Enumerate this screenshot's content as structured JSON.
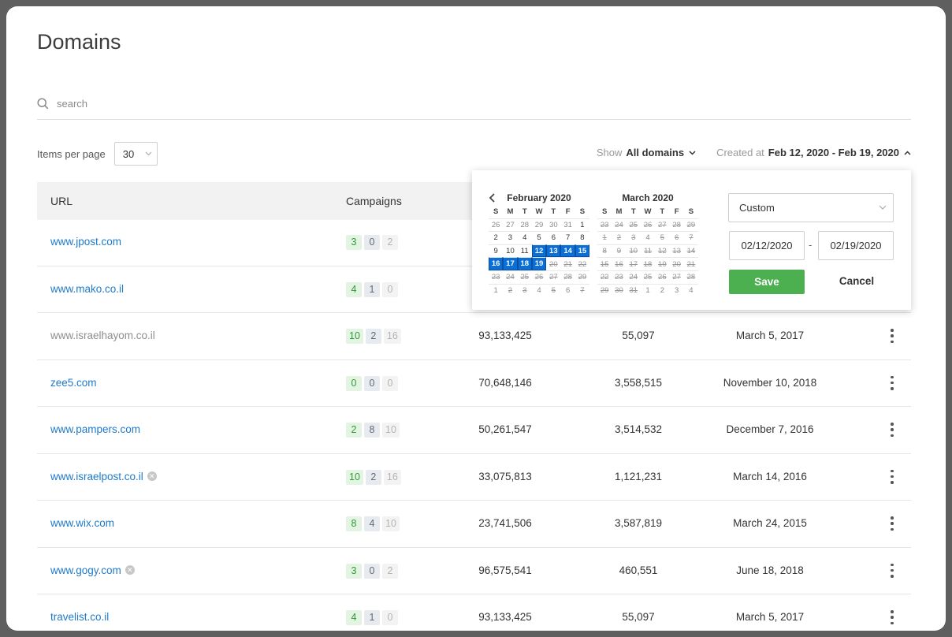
{
  "page": {
    "title": "Domains"
  },
  "search": {
    "placeholder": "search"
  },
  "paging": {
    "label": "Items per page",
    "value": "30"
  },
  "filters": {
    "show_label": "Show",
    "show_value": "All domains",
    "created_label": "Created at",
    "created_value": "Feb 12, 2020 - Feb 19, 2020"
  },
  "table": {
    "headers": {
      "url": "URL",
      "campaigns": "Campaigns"
    },
    "rows": [
      {
        "url": "www.jpost.com",
        "badges": [
          "3",
          "0",
          "2"
        ],
        "c3": "",
        "c4": "",
        "c5": "",
        "x": false,
        "dim": false
      },
      {
        "url": "www.mako.co.il",
        "badges": [
          "4",
          "1",
          "0"
        ],
        "c3": "",
        "c4": "",
        "c5": "",
        "x": false,
        "dim": false
      },
      {
        "url": "www.israelhayom.co.il",
        "badges": [
          "10",
          "2",
          "16"
        ],
        "c3": "93,133,425",
        "c4": "55,097",
        "c5": "March 5, 2017",
        "x": false,
        "dim": true
      },
      {
        "url": "zee5.com",
        "badges": [
          "0",
          "0",
          "0"
        ],
        "c3": "70,648,146",
        "c4": "3,558,515",
        "c5": "November 10, 2018",
        "x": false,
        "dim": false
      },
      {
        "url": "www.pampers.com",
        "badges": [
          "2",
          "8",
          "10"
        ],
        "c3": "50,261,547",
        "c4": "3,514,532",
        "c5": "December 7, 2016",
        "x": false,
        "dim": false
      },
      {
        "url": "www.israelpost.co.il",
        "badges": [
          "10",
          "2",
          "16"
        ],
        "c3": "33,075,813",
        "c4": "1,121,231",
        "c5": "March 14, 2016",
        "x": true,
        "dim": false
      },
      {
        "url": "www.wix.com",
        "badges": [
          "8",
          "4",
          "10"
        ],
        "c3": "23,741,506",
        "c4": "3,587,819",
        "c5": "March 24, 2015",
        "x": false,
        "dim": false
      },
      {
        "url": "www.gogy.com",
        "badges": [
          "3",
          "0",
          "2"
        ],
        "c3": "96,575,541",
        "c4": "460,551",
        "c5": "June 18, 2018",
        "x": true,
        "dim": false
      },
      {
        "url": "travelist.co.il",
        "badges": [
          "4",
          "1",
          "0"
        ],
        "c3": "93,133,425",
        "c4": "55,097",
        "c5": "March 5, 2017",
        "x": false,
        "dim": false
      }
    ]
  },
  "datepicker": {
    "weekdays": [
      "S",
      "M",
      "T",
      "W",
      "T",
      "F",
      "S"
    ],
    "months": [
      {
        "name": "February 2020",
        "weeks": [
          [
            "26",
            "27",
            "28",
            "29",
            "30",
            "31",
            "1"
          ],
          [
            "2",
            "3",
            "4",
            "5",
            "6",
            "7",
            "8"
          ],
          [
            "9",
            "10",
            "11",
            "12",
            "13",
            "14",
            "15"
          ],
          [
            "16",
            "17",
            "18",
            "19",
            "20",
            "21",
            "22"
          ],
          [
            "23",
            "24",
            "25",
            "26",
            "27",
            "28",
            "29"
          ],
          [
            "1",
            "2",
            "3",
            "4",
            "5",
            "6",
            "7"
          ]
        ],
        "states": [
          [
            "oth",
            "oth",
            "oth",
            "oth",
            "oth",
            "oth",
            "cur"
          ],
          [
            "cur",
            "cur",
            "cur",
            "cur",
            "cur",
            "cur",
            "cur"
          ],
          [
            "cur",
            "cur",
            "cur",
            "sel",
            "sel",
            "sel",
            "sel"
          ],
          [
            "sel",
            "sel",
            "sel",
            "sel",
            "dis",
            "dis",
            "dis"
          ],
          [
            "dis",
            "dis",
            "dis",
            "dis",
            "dis",
            "dis",
            "dis"
          ],
          [
            "oth",
            "dis",
            "dis",
            "oth",
            "dis",
            "oth",
            "dis"
          ]
        ]
      },
      {
        "name": "March 2020",
        "weeks": [
          [
            "23",
            "24",
            "25",
            "26",
            "27",
            "28",
            "29"
          ],
          [
            "1",
            "2",
            "3",
            "4",
            "5",
            "6",
            "7"
          ],
          [
            "8",
            "9",
            "10",
            "11",
            "12",
            "13",
            "14"
          ],
          [
            "15",
            "16",
            "17",
            "18",
            "19",
            "20",
            "21"
          ],
          [
            "22",
            "23",
            "24",
            "25",
            "26",
            "27",
            "28"
          ],
          [
            "29",
            "30",
            "31",
            "1",
            "2",
            "3",
            "4"
          ]
        ],
        "states": [
          [
            "dis",
            "dis",
            "dis",
            "dis",
            "dis",
            "dis",
            "dis"
          ],
          [
            "dis",
            "dis",
            "dis",
            "oth",
            "dis",
            "dis",
            "dis"
          ],
          [
            "dis",
            "dis",
            "dis",
            "dis",
            "dis",
            "dis",
            "dis"
          ],
          [
            "dis",
            "dis",
            "dis",
            "dis",
            "dis",
            "dis",
            "dis"
          ],
          [
            "dis",
            "dis",
            "dis",
            "dis",
            "dis",
            "dis",
            "dis"
          ],
          [
            "dis",
            "dis",
            "dis",
            "oth",
            "oth",
            "oth",
            "oth"
          ]
        ]
      }
    ],
    "range_type": "Custom",
    "from": "02/12/2020",
    "to": "02/19/2020",
    "separator": "-",
    "save_label": "Save",
    "cancel_label": "Cancel"
  },
  "colors": {
    "link": "#1f7ac9",
    "accent": "#0a6fd6",
    "save": "#4caf50"
  }
}
